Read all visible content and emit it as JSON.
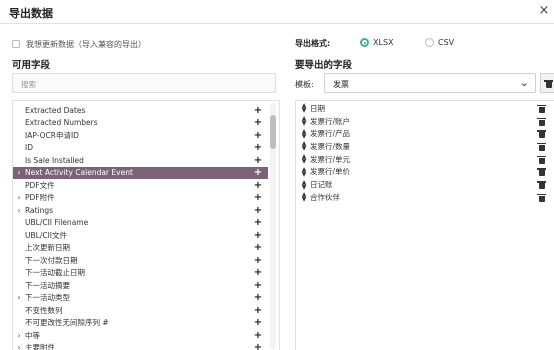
{
  "dialog": {
    "title": "导出数据",
    "close_glyph": "×"
  },
  "update_option": {
    "label": "我想更新数据（导入兼容的导出）",
    "checked": false
  },
  "available": {
    "title": "可用字段",
    "search_placeholder": "搜索",
    "fields": [
      {
        "label": "Extracted Dates",
        "expandable": false,
        "selected": false
      },
      {
        "label": "Extracted Numbers",
        "expandable": false,
        "selected": false
      },
      {
        "label": "IAP-OCR申请ID",
        "expandable": false,
        "selected": false
      },
      {
        "label": "ID",
        "expandable": false,
        "selected": false
      },
      {
        "label": "Is Sale Installed",
        "expandable": false,
        "selected": false
      },
      {
        "label": "Next Activity Calendar Event",
        "expandable": true,
        "selected": true
      },
      {
        "label": "PDF文件",
        "expandable": false,
        "selected": false
      },
      {
        "label": "PDF附件",
        "expandable": true,
        "selected": false
      },
      {
        "label": "Ratings",
        "expandable": true,
        "selected": false
      },
      {
        "label": "UBL/CII Filename",
        "expandable": false,
        "selected": false
      },
      {
        "label": "UBL/CII文件",
        "expandable": false,
        "selected": false
      },
      {
        "label": "上次更新日期",
        "expandable": false,
        "selected": false
      },
      {
        "label": "下一次付款日期",
        "expandable": false,
        "selected": false
      },
      {
        "label": "下一活动截止日期",
        "expandable": false,
        "selected": false
      },
      {
        "label": "下一活动摘要",
        "expandable": false,
        "selected": false
      },
      {
        "label": "下一活动类型",
        "expandable": true,
        "selected": false
      },
      {
        "label": "不变性数列",
        "expandable": false,
        "selected": false
      },
      {
        "label": "不可更改性无间隙序列 #",
        "expandable": false,
        "selected": false
      },
      {
        "label": "中等",
        "expandable": true,
        "selected": false
      },
      {
        "label": "主要附件",
        "expandable": true,
        "selected": false
      }
    ],
    "add_glyph": "+",
    "expand_glyph": "›"
  },
  "format": {
    "label": "导出格式:",
    "options": [
      {
        "label": "XLSX",
        "selected": true
      },
      {
        "label": "CSV",
        "selected": false
      }
    ]
  },
  "export_fields": {
    "title": "要导出的字段",
    "template_label": "模板:",
    "template_value": "发票",
    "template_chevron": "⌄",
    "items": [
      "日期",
      "发票行/账户",
      "发票行/产品",
      "发票行/数量",
      "发票行/单元",
      "发票行/单价",
      "日记账",
      "合作伙伴"
    ]
  }
}
